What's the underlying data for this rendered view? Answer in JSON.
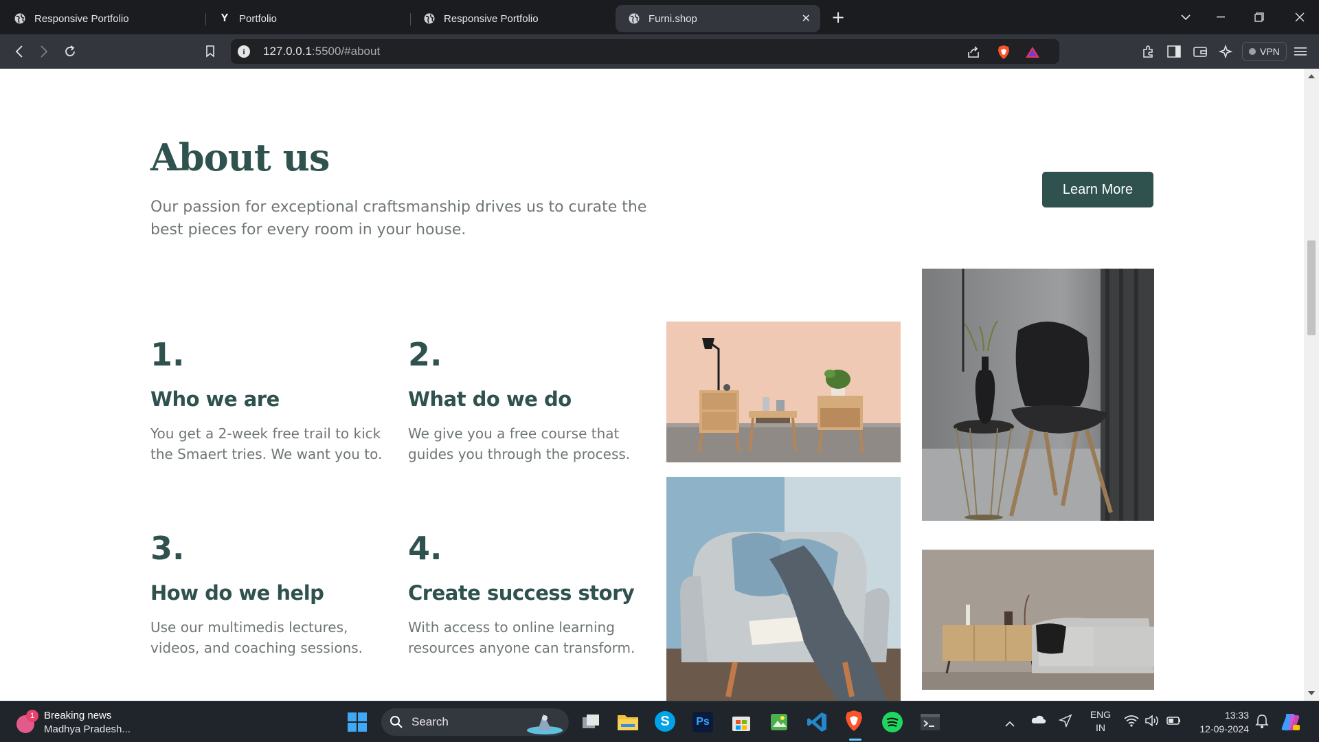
{
  "browser": {
    "tabs": [
      {
        "title": "Responsive Portfolio",
        "icon": "globe-icon"
      },
      {
        "title": "Portfolio",
        "icon": "y-logo-icon"
      },
      {
        "title": "Responsive Portfolio",
        "icon": "globe-icon"
      },
      {
        "title": "Furni.shop",
        "icon": "globe-icon",
        "active": true
      }
    ],
    "url_host": "127.0.0.1",
    "url_rest": ":5500/#about",
    "vpn_label": "VPN"
  },
  "page": {
    "title": "About us",
    "intro": "Our passion for exceptional craftsmanship drives us to curate the best pieces for every room in your house.",
    "learn_more": "Learn More",
    "features": [
      {
        "num": "1.",
        "heading": "Who we are",
        "text": "You get a 2-week free trail to kick the Smaert tries. We want you to."
      },
      {
        "num": "2.",
        "heading": "What do we do",
        "text": "We give you a free course that guides you through the process."
      },
      {
        "num": "3.",
        "heading": "How do we help",
        "text": "Use our multimedis lectures, videos, and coaching sessions."
      },
      {
        "num": "4.",
        "heading": "Create success story",
        "text": "With access to online learning resources anyone can transform."
      }
    ]
  },
  "taskbar": {
    "news_badge": "1",
    "news_title": "Breaking news",
    "news_sub": "Madhya Pradesh...",
    "search_label": "Search",
    "lang_top": "ENG",
    "lang_bottom": "IN",
    "time": "13:33",
    "date": "12-09-2024"
  },
  "colors": {
    "accent": "#2f524f",
    "body_text": "#6f7773"
  }
}
